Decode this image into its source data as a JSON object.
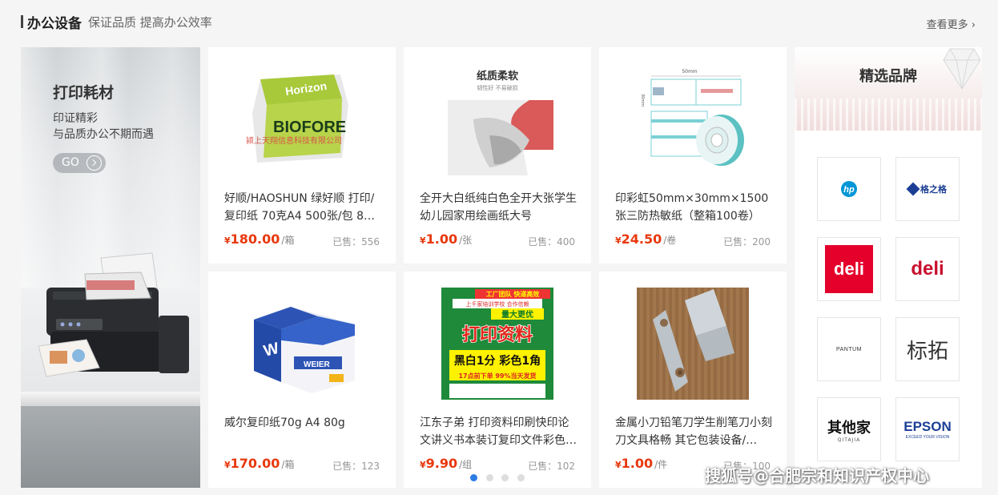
{
  "section": {
    "title": "办公设备",
    "subtitle": "保证品质 提高办公效率",
    "more_label": "查看更多 ›"
  },
  "banner": {
    "title": "打印耗材",
    "line1": "印证精彩",
    "line2": "与品质办公不期而遇",
    "go_label": "GO"
  },
  "products": [
    {
      "name": "好顺/HAOSHUN 绿好顺 打印/复印纸 70克A4 500张/包 8包…",
      "currency": "¥",
      "price": "180.00",
      "unit": "/箱",
      "sold": "已售：556",
      "image": {
        "brand": "Horizon",
        "sub": "BIOFORE",
        "caption": "颍上天翔信息科技有限公司"
      }
    },
    {
      "name": "全开大白纸纯白色全开大张学生幼儿园家用绘画纸大号",
      "currency": "¥",
      "price": "1.00",
      "unit": "/张",
      "sold": "已售：400",
      "image": {
        "title": "纸质柔软",
        "sub": "韧性好 不易破损"
      }
    },
    {
      "name": "印彩虹50mm×30mm×1500张三防热敏纸（整箱100卷）",
      "currency": "¥",
      "price": "24.50",
      "unit": "/卷",
      "sold": "已售：200",
      "image": {
        "dim_top": "50mm",
        "dim_side": "30mm"
      }
    },
    {
      "name": "威尔复印纸70g A4 80g",
      "currency": "¥",
      "price": "170.00",
      "unit": "/箱",
      "sold": "已售：123",
      "image": {
        "brand": "WEIER"
      }
    },
    {
      "name": "江东子弟 打印资料印刷快印论文讲义书本装订复印文件彩色…",
      "currency": "¥",
      "price": "9.90",
      "unit": "/组",
      "sold": "已售：102",
      "image": {
        "badge": "工厂团队 快递高效",
        "sub": "上千家培训学校 合作信赖",
        "ribbon": "量大更优",
        "main": "打印资料",
        "price_text": "黑白1分 彩色1角",
        "footer": "17点前下单 99%当天发货"
      }
    },
    {
      "name": "金属小刀铅笔刀学生削笔刀小刻刀文具格畅 其它包装设备/…",
      "currency": "¥",
      "price": "1.00",
      "unit": "/件",
      "sold": "已售：100",
      "image": {}
    }
  ],
  "brands": {
    "title": "精选品牌",
    "items": [
      {
        "name": "hp"
      },
      {
        "name": "格之格"
      },
      {
        "name": "deli"
      },
      {
        "name": "deli"
      },
      {
        "name": "PANTUM"
      },
      {
        "name": "标拓"
      },
      {
        "name": "其他家",
        "sub": "QITAJIA"
      },
      {
        "name": "EPSON",
        "sub": "EXCEED YOUR VISION"
      }
    ]
  },
  "carousel": {
    "count": 4,
    "active": 0
  },
  "watermark": "搜狐号@合肥宗和知识产权中心",
  "colors": {
    "price": "#e8380d",
    "deli_red": "#e4002b",
    "epson_blue": "#1c3f95",
    "hp_blue": "#0096d6",
    "dot_active": "#2c7be5"
  }
}
